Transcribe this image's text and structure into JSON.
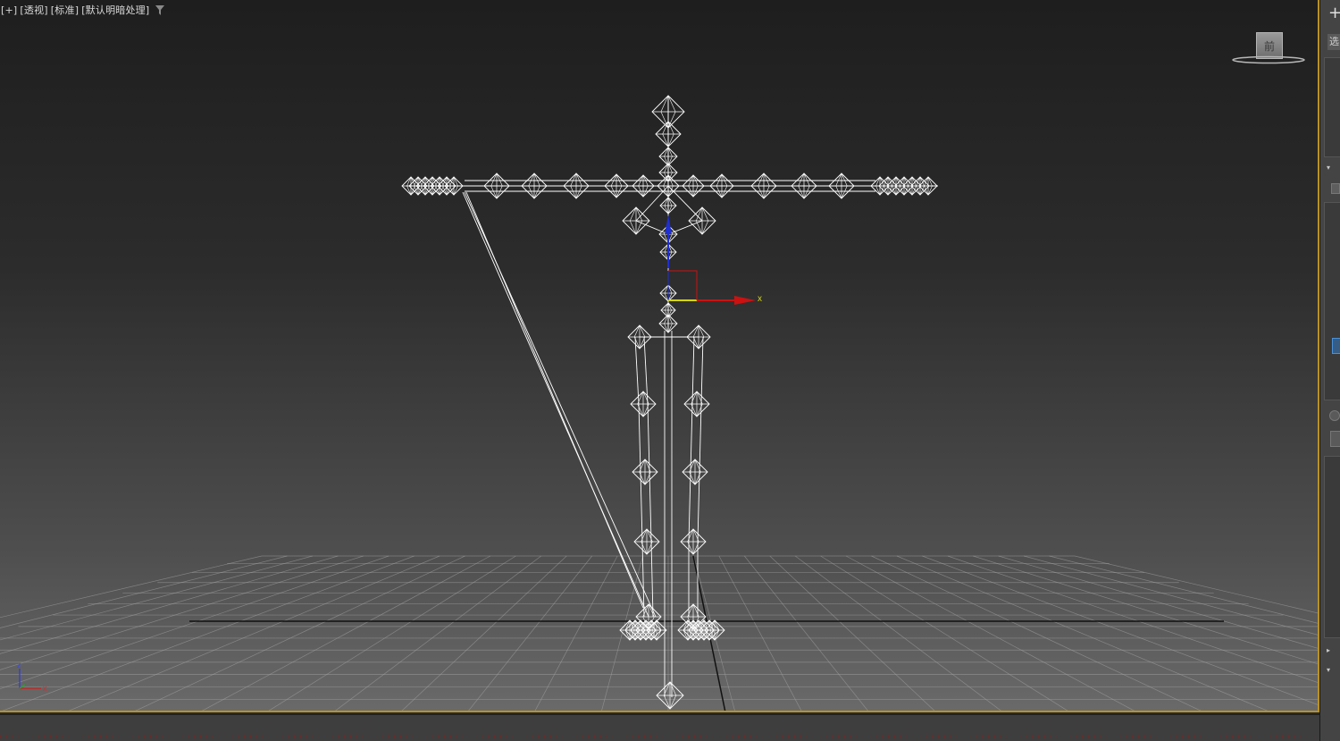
{
  "viewport": {
    "label_parts": [
      "[+]",
      "[透视]",
      "[标准]",
      "[默认明暗处理]"
    ],
    "filter_icon": "filter-funnel-icon",
    "gizmo_x_label": "x",
    "axis_labels": {
      "x": "x",
      "z": "z"
    }
  },
  "viewcube": {
    "face_label": "前",
    "ring_icon": "compass-ring-icon"
  },
  "command_panel": {
    "create_icon": "plus-icon",
    "tab_label": "选",
    "arrows": [
      "▾",
      "▾",
      "▾",
      "▸",
      "▾"
    ]
  },
  "colors": {
    "viewport_border": "#b89224",
    "gizmo_x": "#cc1111",
    "gizmo_y": "#d6d60a",
    "gizmo_z": "#1f2fd0",
    "wireframe": "#ffffff",
    "grid": "#9a9a9a"
  }
}
